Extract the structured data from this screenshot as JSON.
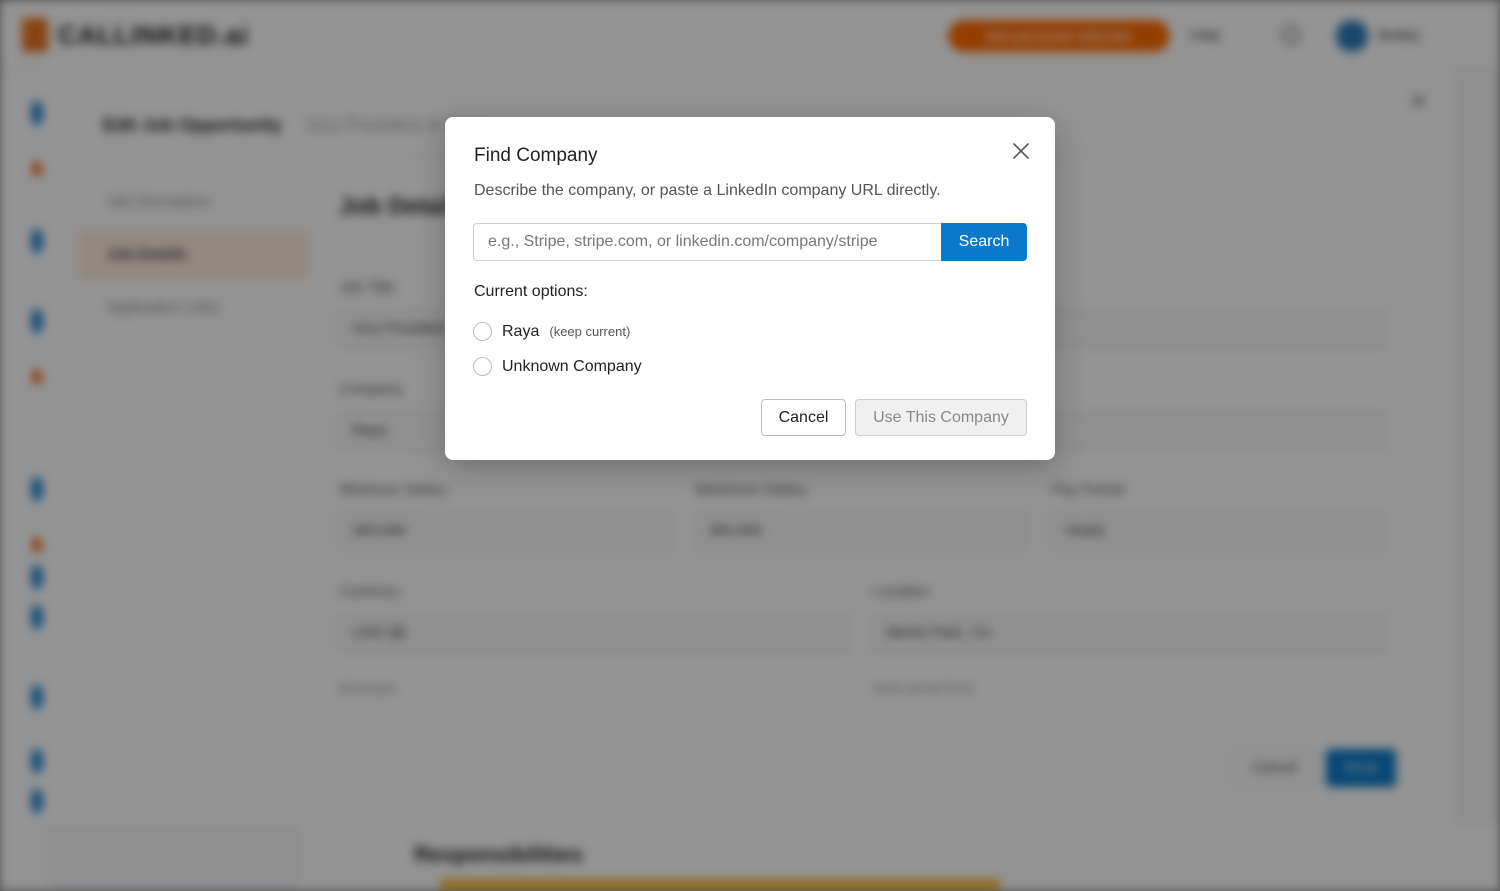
{
  "background": {
    "brand": "CALLINKED.ai",
    "top_cta": "Get personal referrals",
    "help_label": "Help",
    "user_label": "Bobby",
    "edit_modal": {
      "title": "Edit Job Opportunity",
      "subtitle": "Vice President at Raya",
      "nav": [
        "Job Description",
        "Job Details",
        "Application Links"
      ],
      "section_title": "Job Details",
      "fields": {
        "job_title_label": "Job Title",
        "job_title_value": "Vice President",
        "company_label": "Company",
        "company_value": "Raya",
        "min_salary_label": "Minimum Salary",
        "min_salary_value": "300,000",
        "max_salary_label": "Maximum Salary",
        "max_salary_value": "350,000",
        "pay_period_label": "Pay Period",
        "pay_period_value": "Yearly",
        "currency_label": "Currency",
        "currency_value": "USD ($)",
        "location_label": "Location",
        "location_value": "Menlo Park, CA",
        "workstyle_label": "Workstyle",
        "work_period_label": "Work period Post"
      },
      "cancel_label": "Cancel",
      "save_label": "Save"
    },
    "responsibilities_title": "Responsibilities"
  },
  "dialog": {
    "title": "Find Company",
    "description": "Describe the company, or paste a LinkedIn company URL directly.",
    "search": {
      "placeholder": "e.g., Stripe, stripe.com, or linkedin.com/company/stripe",
      "value": "",
      "button_label": "Search"
    },
    "options_label": "Current options:",
    "options": [
      {
        "name": "Raya",
        "note": "(keep current)",
        "selected": false
      },
      {
        "name": "Unknown Company",
        "note": "",
        "selected": false
      }
    ],
    "cancel_label": "Cancel",
    "confirm_label": "Use This Company"
  },
  "colors": {
    "primary": "#0a79c9",
    "accent": "#ff6a00",
    "overlay": "rgba(0,0,0,0.42)"
  },
  "icons": {
    "close": "close-icon"
  }
}
